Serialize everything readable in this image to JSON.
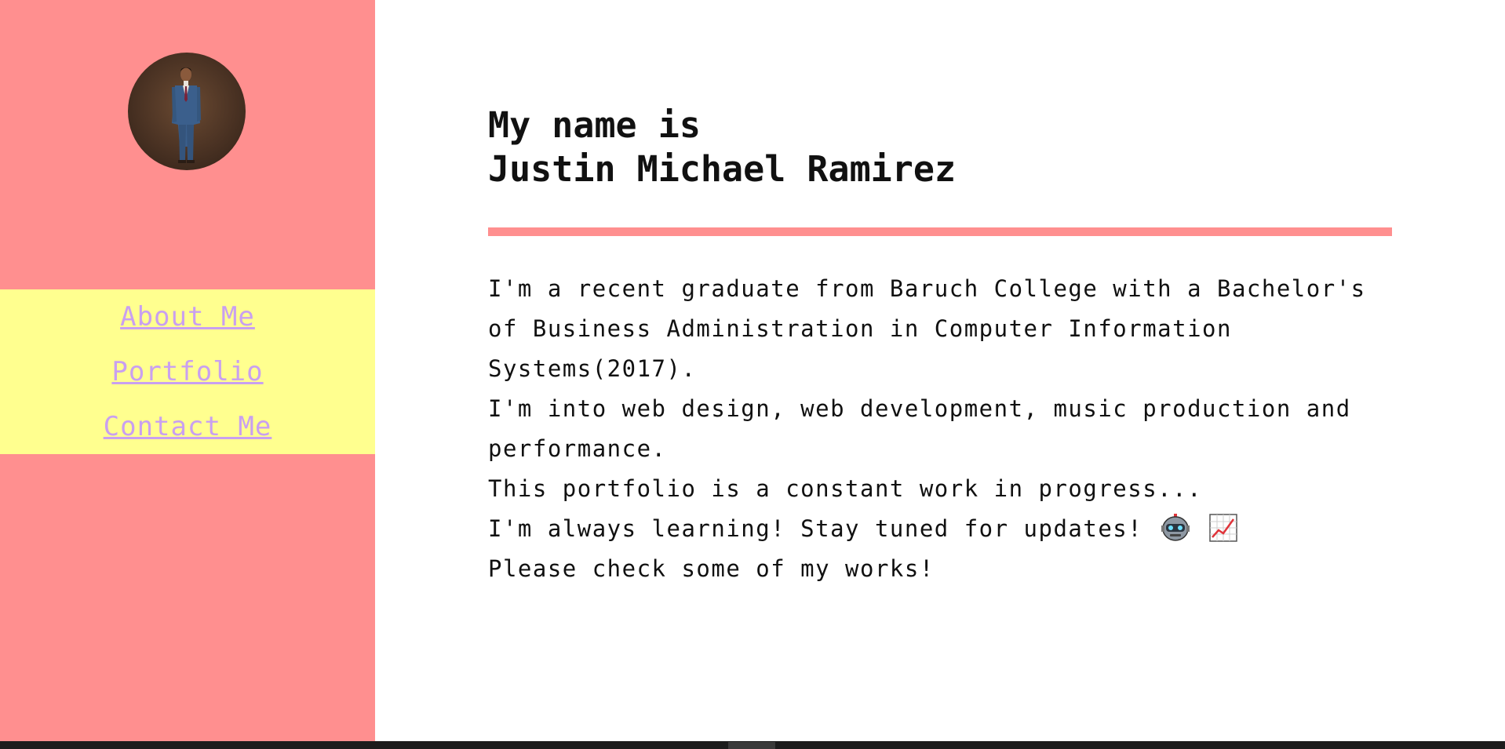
{
  "profile": {
    "avatar_alt": "Profile photo"
  },
  "nav": {
    "items": [
      {
        "label": "About Me"
      },
      {
        "label": "Portfolio"
      },
      {
        "label": "Contact Me"
      }
    ]
  },
  "main": {
    "heading_line1": "My name is",
    "heading_line2": "Justin Michael Ramirez",
    "bio": [
      "I'm a recent graduate from Baruch College with a Bachelor's of Business Administration in Computer Information Systems(2017).",
      "I'm into web design, web development, music production and performance.",
      "This portfolio is a constant work in progress...",
      "I'm always learning! Stay tuned for updates!",
      "Please check some of my works!"
    ],
    "emoji_icons": [
      "robot-icon",
      "chart-increasing-icon"
    ]
  },
  "colors": {
    "sidebar": "#ff8f8f",
    "nav_background": "#ffff8f",
    "nav_link": "#c9a0f0",
    "divider": "#ff8f8f",
    "text": "#111111"
  }
}
